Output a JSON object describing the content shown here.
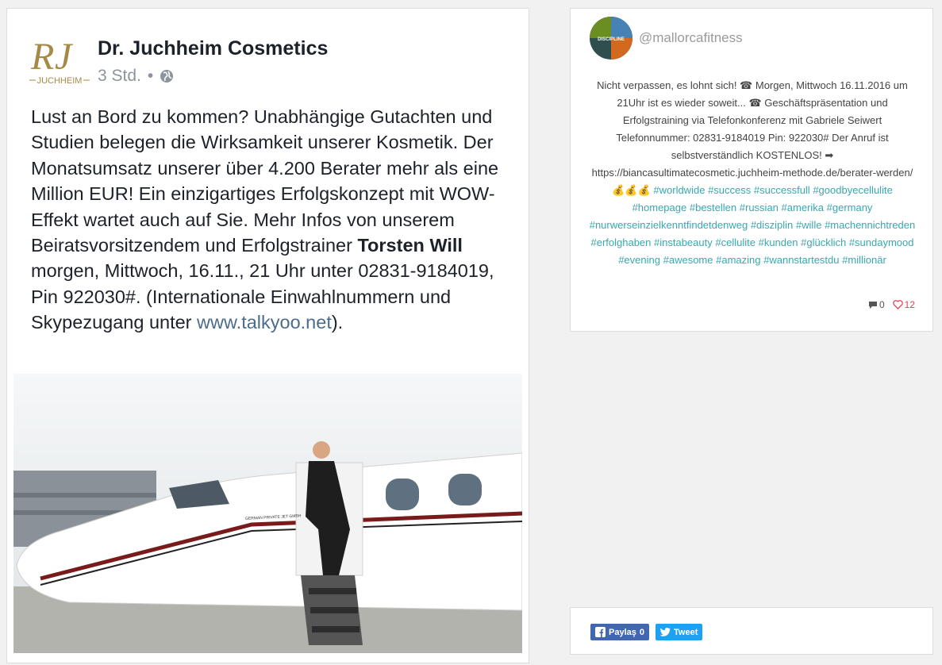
{
  "post": {
    "page_name": "Dr. Juchheim Cosmetics",
    "time": "3 Std.",
    "separator": "•",
    "logo_text": "JUCHHEIM",
    "text_1": "Lust an Bord zu kommen? Unabhängige Gutachten und Studien belegen die Wirksamkeit unserer Kosmetik. Der Monatsumsatz unserer über 4.200 Berater mehr als eine Million EUR! Ein einzigartiges Erfolgskonzept mit WOW-Effekt wartet auch auf Sie. Mehr Infos von unserem Beiratsvorsitzendem und Erfolgstrainer ",
    "bold_name": "Torsten Will",
    "text_2": " morgen, Mittwoch, 16.11., 21 Uhr unter 02831-9184019, Pin 922030#. (Internationale Einwahlnummern und Skypezugang unter ",
    "link": "www.talkyoo.net",
    "text_3": ").",
    "photo_label": "GERMAN PRIVATE JET GMBH"
  },
  "instagram": {
    "username": "@mallorcafitness",
    "caption": "Nicht verpassen, es lohnt sich! ☎ Morgen, Mittwoch 16.11.2016 um 21Uhr ist es wieder soweit... ☎ Geschäftspräsentation und Erfolgstraining via Telefonkonferenz mit Gabriele Seiwert Telefonnummer: 02831-9184019 Pin: 922030# Der Anruf ist selbstverständlich KOSTENLOS! ➡ https://biancasultimatecosmetic.juchheim-methode.de/berater-werden/ 💰💰💰",
    "hashtags": [
      "#worldwide",
      "#success",
      "#successfull",
      "#goodbyecellulite",
      "#homepage",
      "#bestellen",
      "#russian",
      "#amerika",
      "#germany",
      "#nurwerseinzielkenntfindetdenweg",
      "#disziplin",
      "#wille",
      "#machennichtreden",
      "#erfolghaben",
      "#instabeauty",
      "#cellulite",
      "#kunden",
      "#glücklich",
      "#sundaymood",
      "#evening",
      "#awesome",
      "#amazing",
      "#wannstartestdu",
      "#millionär"
    ],
    "comments": "0",
    "likes": "12",
    "avatar_text": "DISCIPLINE"
  },
  "share": {
    "facebook_label": "Paylaş",
    "facebook_count": "0",
    "tweet_label": "Tweet"
  },
  "colors": {
    "hashtag": "#38a8b0",
    "facebook": "#4267b2",
    "twitter": "#1da1f2",
    "like": "#e0435a"
  }
}
